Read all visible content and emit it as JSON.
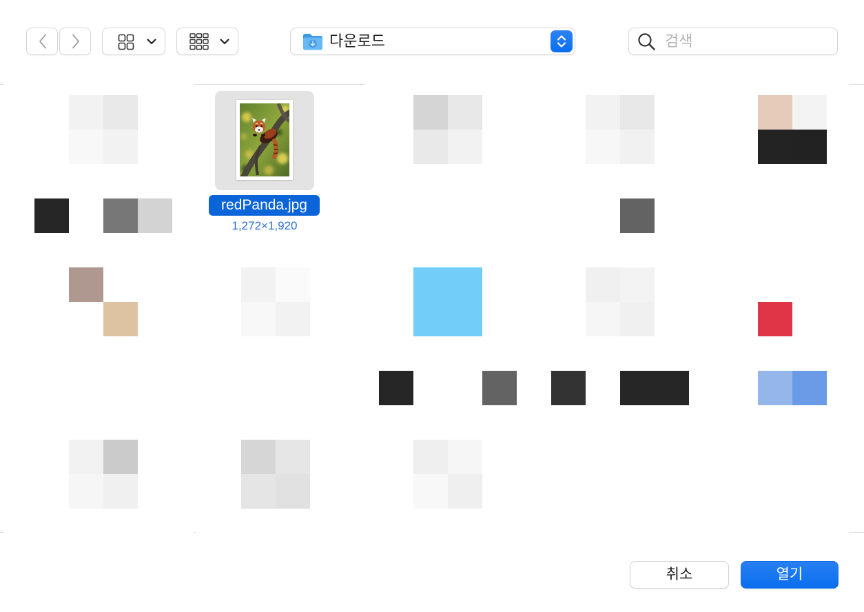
{
  "toolbar": {
    "back": {
      "icon": "chevron-left-icon",
      "enabled": false
    },
    "forward": {
      "icon": "chevron-right-icon",
      "enabled": false
    },
    "view_mode": {
      "icon": "icon-view-icon",
      "chevron": "chevron-down-icon"
    },
    "group_by": {
      "icon": "group-icon",
      "chevron": "chevron-down-icon"
    },
    "location": {
      "label": "다운로드",
      "icon": "downloads-folder-icon",
      "stepper_icon": "up-down-chevron-icon"
    },
    "search": {
      "placeholder": "검색",
      "value": "",
      "icon": "search-icon"
    }
  },
  "files": [
    {
      "mosaic": {
        "thumb": [
          "#f2f2f2",
          "#e9e9e9",
          "#f8f8f8",
          "#f2f2f2"
        ],
        "label": [
          null,
          "#262626",
          null,
          "#777777",
          "#d3d3d3"
        ]
      }
    },
    {
      "name": "redPanda.jpg",
      "dimensions": "1,272×1,920",
      "selected": true
    },
    {
      "mosaic": {
        "thumb": [
          "#d5d5d5",
          "#e8e8e8",
          "#e9e9e9",
          "#f2f2f2"
        ],
        "label": []
      }
    },
    {
      "mosaic": {
        "thumb": [
          "#f2f2f2",
          "#e8e8e8",
          "#f7f7f7",
          "#f1f1f1"
        ],
        "label": [
          null,
          null,
          null,
          "#636363",
          null
        ]
      }
    },
    {
      "mosaic": {
        "thumb": [
          "#e6cbbb",
          "#f3f3f3",
          "#232323",
          "#222222"
        ],
        "label": []
      }
    },
    {
      "mosaic": {
        "thumb": [
          "#af9890",
          null,
          null,
          "#dec3a2"
        ],
        "label": []
      }
    },
    {
      "mosaic": {
        "thumb": [
          "#f2f2f2",
          "#fafafa",
          "#f8f8f8",
          "#f2f2f2"
        ],
        "label": []
      }
    },
    {
      "mosaic": {
        "thumb": [
          "#72cef8",
          "#72cef8",
          "#72cef8",
          "#72cef8"
        ],
        "label": [
          null,
          "#262626",
          null,
          null,
          "#636363"
        ]
      }
    },
    {
      "mosaic": {
        "thumb": [
          "#f0f0f0",
          "#f3f3f3",
          "#f6f6f6",
          "#f0f0f0"
        ],
        "label": [
          null,
          "#333333",
          null,
          "#262626",
          "#262626"
        ]
      }
    },
    {
      "mosaic": {
        "thumb": [
          null,
          null,
          "#df3546",
          null
        ],
        "label": [
          null,
          null,
          "#94b6ea",
          "#6b9be6",
          null
        ]
      }
    },
    {
      "mosaic": {
        "thumb": [
          "#f2f2f2",
          "#cbcbcb",
          "#f6f6f6",
          "#f0f0f0"
        ],
        "label": []
      }
    },
    {
      "mosaic": {
        "thumb": [
          "#d6d6d6",
          "#e6e6e6",
          "#e5e5e5",
          "#e1e1e1"
        ],
        "label": []
      }
    },
    {
      "mosaic": {
        "thumb": [
          "#efefef",
          "#f6f6f6",
          "#f8f8f8",
          "#efefef"
        ],
        "label": []
      }
    }
  ],
  "buttons": {
    "cancel": "취소",
    "open": "열기"
  },
  "colors": {
    "accent": "#0a6ef0",
    "selection_label_bg": "#0b64d8",
    "selection_tile_bg": "#e3e3e3",
    "dimensions_text": "#2b6fd3",
    "placeholder_text": "#b4b4b4",
    "disabled_icon": "#a0a0a0"
  }
}
